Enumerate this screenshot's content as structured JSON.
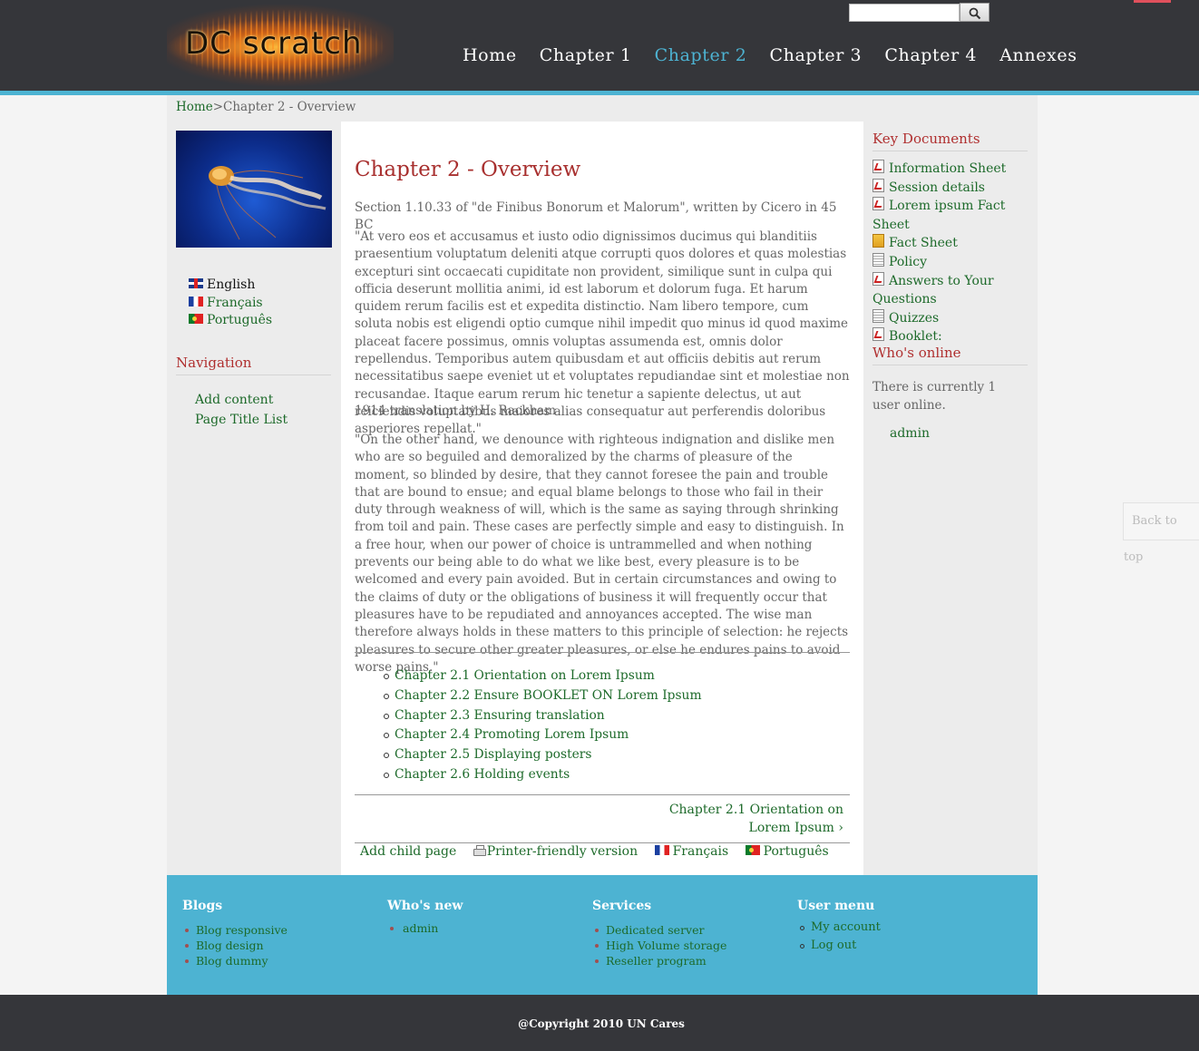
{
  "header": {
    "logo_text": "DC scratch",
    "search": {
      "placeholder": "",
      "value": ""
    },
    "nav": [
      "Home",
      "Chapter 1",
      "Chapter 2",
      "Chapter 3",
      "Chapter 4",
      "Annexes"
    ],
    "active_nav": "Chapter 2"
  },
  "breadcrumb": {
    "home": "Home",
    "separator": ">",
    "current": "Chapter 2 - Overview"
  },
  "left_sidebar": {
    "languages": [
      "English",
      "Français",
      "Português"
    ],
    "navigation_title": "Navigation",
    "navigation_links": [
      "Add content",
      "Page Title List"
    ]
  },
  "content": {
    "title": "Chapter 2 - Overview",
    "intro": "Section 1.10.33 of \"de Finibus Bonorum et Malorum\", written by Cicero in 45 BC",
    "latin": "\"At vero eos et accusamus et iusto odio dignissimos ducimus qui blanditiis praesentium voluptatum deleniti atque corrupti quos dolores et quas molestias excepturi sint occaecati cupiditate non provident, similique sunt in culpa qui officia deserunt mollitia animi, id est laborum et dolorum fuga. Et harum quidem rerum facilis est et expedita distinctio. Nam libero tempore, cum soluta nobis est eligendi optio cumque nihil impedit quo minus id quod maxime placeat facere possimus, omnis voluptas assumenda est, omnis dolor repellendus. Temporibus autem quibusdam et aut officiis debitis aut rerum necessitatibus saepe eveniet ut et voluptates repudiandae sint et molestiae non recusandae. Itaque earum rerum hic tenetur a sapiente delectus, ut aut reiciendis voluptatibus maiores alias consequatur aut perferendis doloribus asperiores repellat.\"",
    "translation_note": "1914 translation by H. Rackham",
    "english": "\"On the other hand, we denounce with righteous indignation and dislike men who are so beguiled and demoralized by the charms of pleasure of the moment, so blinded by desire, that they cannot foresee the pain and trouble that are bound to ensue; and equal blame belongs to those who fail in their duty through weakness of will, which is the same as saying through shrinking from toil and pain. These cases are perfectly simple and easy to distinguish. In a free hour, when our power of choice is untrammelled and when nothing prevents our being able to do what we like best, every pleasure is to be welcomed and every pain avoided. But in certain circumstances and owing to the claims of duty or the obligations of business it will frequently occur that pleasures have to be repudiated and annoyances accepted. The wise man therefore always holds in these matters to this principle of selection: he rejects pleasures to secure other greater pleasures, or else he endures pains to avoid worse pains.\"",
    "chapters": [
      "Chapter 2.1 Orientation on Lorem Ipsum",
      "Chapter 2.2 Ensure BOOKLET ON Lorem Ipsum",
      "Chapter 2.3 Ensuring translation",
      "Chapter 2.4 Promoting Lorem Ipsum",
      "Chapter 2.5 Displaying posters",
      "Chapter 2.6 Holding events"
    ],
    "next_link": "Chapter 2.1 Orientation on Lorem Ipsum ›",
    "links": {
      "add_child": "Add child page",
      "printer": "Printer-friendly version",
      "french": "Français",
      "portuguese": "Português"
    }
  },
  "right_sidebar": {
    "key_documents_title": "Key Documents",
    "documents": [
      {
        "label": "Information Sheet",
        "icon": "pdf-icon"
      },
      {
        "label": "Session details",
        "icon": "pdf-icon"
      },
      {
        "label": "Lorem ipsum Fact Sheet",
        "icon": "pdf-icon"
      },
      {
        "label": "Fact Sheet",
        "icon": "zip-icon"
      },
      {
        "label": "Policy",
        "icon": "text-file-icon"
      },
      {
        "label": "Answers to Your Questions",
        "icon": "pdf-icon"
      },
      {
        "label": "Quizzes",
        "icon": "text-file-icon"
      },
      {
        "label": "Booklet:",
        "icon": "pdf-icon"
      }
    ],
    "whos_online_title": "Who's online",
    "whos_online_text": "There is currently 1 user online.",
    "online_user": "admin"
  },
  "back_to_top": "Back to top",
  "footer": {
    "blogs": {
      "title": "Blogs",
      "items": [
        "Blog responsive",
        "Blog design",
        "Blog dummy"
      ]
    },
    "whos_new": {
      "title": "Who's new",
      "items": [
        "admin"
      ]
    },
    "services": {
      "title": "Services",
      "items": [
        "Dedicated server",
        "High Volume storage",
        "Reseller program"
      ]
    },
    "user_menu": {
      "title": "User menu",
      "items": [
        "My account",
        "Log out"
      ]
    },
    "copyright": "@Copyright 2010 UN Cares"
  },
  "colors": {
    "header_bg": "#35363a",
    "accent": "#4db3d2",
    "title_red": "#a8302f",
    "link_green": "#1d6a2a"
  }
}
